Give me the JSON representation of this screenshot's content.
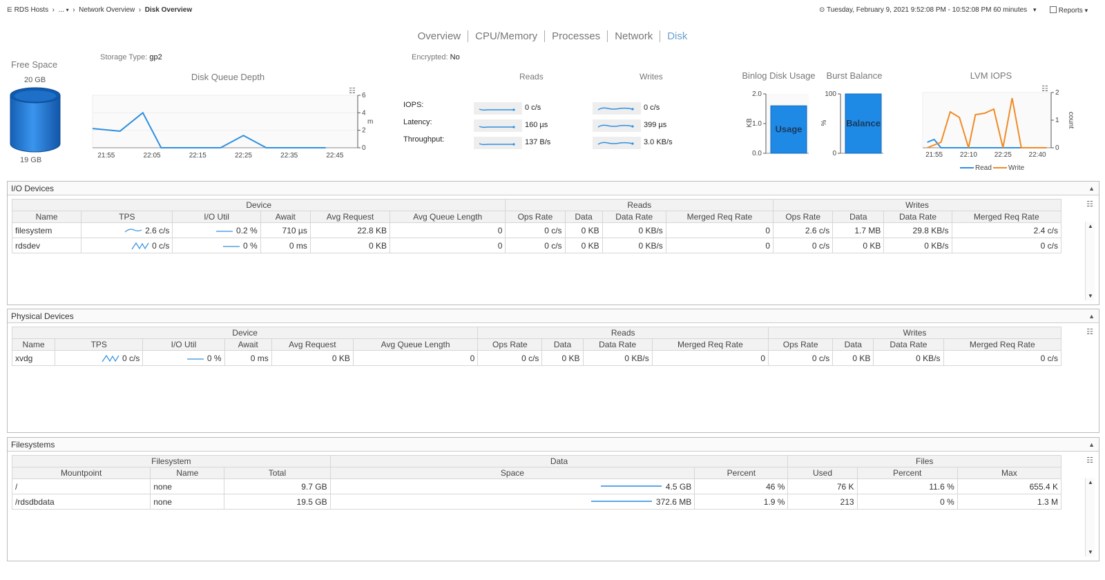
{
  "breadcrumb": {
    "home": "RDS Hosts",
    "ellipsis": "...",
    "network": "Network Overview",
    "current": "Disk Overview"
  },
  "timerange": {
    "text": "Tuesday, February 9, 2021 9:52:08 PM - 10:52:08 PM 60 minutes"
  },
  "reports_label": "Reports",
  "tabs": [
    "Overview",
    "CPU/Memory",
    "Processes",
    "Network",
    "Disk"
  ],
  "active_tab": "Disk",
  "free_space": {
    "title": "Free Space",
    "top": "20 GB",
    "bottom": "19 GB",
    "color": "#1e7fd8"
  },
  "storage_type": {
    "label": "Storage Type:",
    "value": "gp2"
  },
  "encrypted": {
    "label": "Encrypted:",
    "value": "No"
  },
  "queue_chart": {
    "title": "Disk Queue Depth",
    "unit": "m",
    "x_ticks": [
      "21:55",
      "22:05",
      "22:15",
      "22:25",
      "22:35",
      "22:45"
    ],
    "y_ticks": [
      "0",
      "2",
      "4",
      "6"
    ]
  },
  "chart_data": [
    {
      "type": "line",
      "title": "Disk Queue Depth",
      "x": [
        "21:52",
        "21:58",
        "22:03",
        "22:07",
        "22:14",
        "22:20",
        "22:25",
        "22:30",
        "22:37",
        "22:43"
      ],
      "values": [
        2.2,
        1.9,
        4.0,
        0,
        0,
        0,
        1.4,
        0,
        0,
        0
      ],
      "ylim": [
        0,
        6
      ],
      "ylabel": "m",
      "color": "#2f8fe0"
    },
    {
      "type": "bar",
      "title": "Binlog Disk Usage",
      "categories": [
        "Usage"
      ],
      "values": [
        1.6
      ],
      "ylim": [
        0,
        2.0
      ],
      "ylabel": "KB"
    },
    {
      "type": "bar",
      "title": "Burst Balance",
      "categories": [
        "Balance"
      ],
      "values": [
        100
      ],
      "ylim": [
        0,
        100
      ],
      "ylabel": "%"
    },
    {
      "type": "line",
      "title": "LVM IOPS",
      "x": [
        "21:52",
        "21:55",
        "21:58",
        "22:02",
        "22:06",
        "22:10",
        "22:13",
        "22:17",
        "22:21",
        "22:25",
        "22:29",
        "22:33",
        "22:37",
        "22:41",
        "22:44"
      ],
      "series": [
        {
          "name": "Read",
          "values": [
            0.2,
            0.3,
            0,
            0,
            0,
            0,
            0,
            0,
            0,
            0,
            0,
            0,
            0,
            0,
            0
          ],
          "color": "#2f8fe0"
        },
        {
          "name": "Write",
          "values": [
            0,
            0.1,
            0.2,
            1.3,
            1.1,
            0,
            1.2,
            1.25,
            1.4,
            0,
            1.8,
            0,
            0,
            0,
            0
          ],
          "color": "#f08a24"
        }
      ],
      "ylim": [
        0,
        2
      ],
      "ylabel": "count",
      "x_ticks": [
        "21:55",
        "22:10",
        "22:25",
        "22:40"
      ],
      "y_ticks": [
        "0",
        "1",
        "2"
      ]
    }
  ],
  "reads_writes": {
    "reads_title": "Reads",
    "writes_title": "Writes",
    "rows": [
      {
        "label": "IOPS:",
        "read": "0 c/s",
        "write": "0 c/s"
      },
      {
        "label": "Latency:",
        "read": "160 µs",
        "write": "399 µs"
      },
      {
        "label": "Throughput:",
        "read": "137 B/s",
        "write": "3.0 KB/s"
      }
    ]
  },
  "binlog": {
    "title": "Binlog Disk Usage",
    "unit": "KB",
    "bar_label": "Usage",
    "y_ticks": [
      "0.0",
      "1.0",
      "2.0"
    ]
  },
  "burst": {
    "title": "Burst Balance",
    "unit": "%",
    "bar_label": "Balance",
    "y_ticks": [
      "0",
      "100"
    ]
  },
  "lvm": {
    "title": "LVM IOPS",
    "unit": "count",
    "legend_read": "Read",
    "legend_write": "Write"
  },
  "io_devices": {
    "title": "I/O Devices",
    "groups": [
      "Device",
      "Reads",
      "Writes"
    ],
    "columns": [
      "Name",
      "TPS",
      "I/O Util",
      "Await",
      "Avg Request",
      "Avg Queue Length",
      "Ops Rate",
      "Data",
      "Data Rate",
      "Merged Req Rate",
      "Ops Rate",
      "Data",
      "Data Rate",
      "Merged Req Rate"
    ],
    "rows": [
      [
        "filesystem",
        "2.6 c/s",
        "0.2 %",
        "710 µs",
        "22.8 KB",
        "0",
        "0 c/s",
        "0 KB",
        "0 KB/s",
        "0",
        "2.6 c/s",
        "1.7 MB",
        "29.8 KB/s",
        "2.4 c/s"
      ],
      [
        "rdsdev",
        "0 c/s",
        "0 %",
        "0 ms",
        "0 KB",
        "0",
        "0 c/s",
        "0 KB",
        "0 KB/s",
        "0",
        "0 c/s",
        "0 KB",
        "0 KB/s",
        "0 c/s"
      ]
    ]
  },
  "physical_devices": {
    "title": "Physical Devices",
    "groups": [
      "Device",
      "Reads",
      "Writes"
    ],
    "columns": [
      "Name",
      "TPS",
      "I/O Util",
      "Await",
      "Avg Request",
      "Avg Queue Length",
      "Ops Rate",
      "Data",
      "Data Rate",
      "Merged Req Rate",
      "Ops Rate",
      "Data",
      "Data Rate",
      "Merged Req Rate"
    ],
    "rows": [
      [
        "xvdg",
        "0 c/s",
        "0 %",
        "0 ms",
        "0 KB",
        "0",
        "0 c/s",
        "0 KB",
        "0 KB/s",
        "0",
        "0 c/s",
        "0 KB",
        "0 KB/s",
        "0 c/s"
      ]
    ]
  },
  "filesystems": {
    "title": "Filesystems",
    "groups": [
      "Filesystem",
      "Data",
      "Files"
    ],
    "columns": [
      "Mountpoint",
      "Name",
      "Total",
      "Space",
      "Percent",
      "Used",
      "Percent",
      "Max"
    ],
    "rows": [
      [
        "/",
        "none",
        "9.7 GB",
        "4.5 GB",
        "46 %",
        "76 K",
        "11.6 %",
        "655.4 K"
      ],
      [
        "/rdsdbdata",
        "none",
        "19.5 GB",
        "372.6 MB",
        "1.9 %",
        "213",
        "0 %",
        "1.3 M"
      ]
    ]
  }
}
